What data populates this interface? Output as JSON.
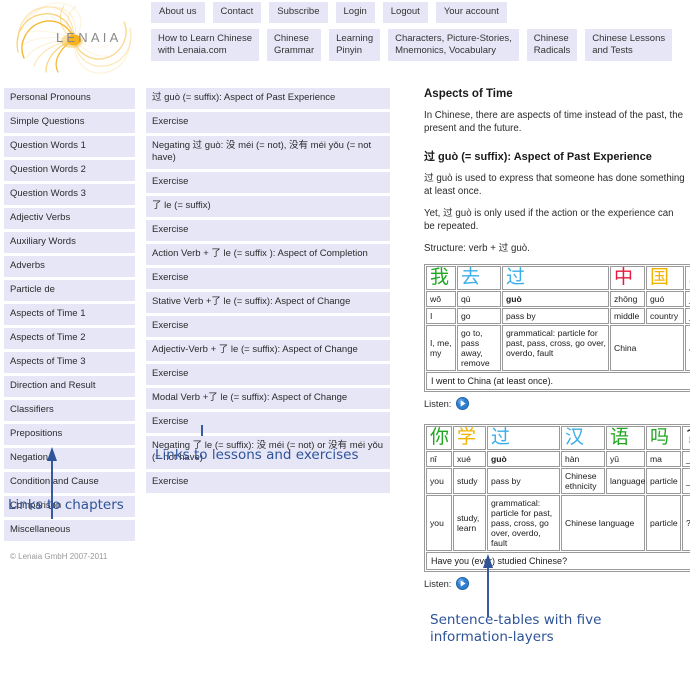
{
  "site": {
    "logo_text": "LENAIA",
    "logo_name": "lenaia-spiral-logo",
    "copyright": "© Lenaia GmbH 2007-2011"
  },
  "nav_top": [
    {
      "label": "About us"
    },
    {
      "label": "Contact"
    },
    {
      "label": "Subscribe"
    },
    {
      "label": "Login"
    },
    {
      "label": "Logout"
    },
    {
      "label": "Your account"
    }
  ],
  "nav_main": [
    {
      "label": "How to Learn Chinese\nwith Lenaia.com"
    },
    {
      "label": "Chinese\nGrammar"
    },
    {
      "label": "Learning\nPinyin"
    },
    {
      "label": "Characters, Picture-Stories,\nMnemonics, Vocabulary"
    },
    {
      "label": "Chinese\nRadicals"
    },
    {
      "label": "Chinese Lessons\nand Tests"
    }
  ],
  "chapters": [
    {
      "label": "Personal Pronouns"
    },
    {
      "label": "Simple Questions"
    },
    {
      "label": "Question Words 1"
    },
    {
      "label": "Question Words 2"
    },
    {
      "label": "Question Words 3"
    },
    {
      "label": "Adjectiv Verbs"
    },
    {
      "label": "Auxiliary Words"
    },
    {
      "label": "Adverbs"
    },
    {
      "label": "Particle de"
    },
    {
      "label": "Aspects of Time 1"
    },
    {
      "label": "Aspects of Time 2"
    },
    {
      "label": "Aspects of Time 3"
    },
    {
      "label": "Direction and Result"
    },
    {
      "label": "Classifiers"
    },
    {
      "label": "Prepositions"
    },
    {
      "label": "Negation"
    },
    {
      "label": "Condition and Cause"
    },
    {
      "label": "Comparison"
    },
    {
      "label": "Miscellaneous"
    }
  ],
  "lessons": [
    {
      "label": "过 guò (= suffix): Aspect of Past Experience"
    },
    {
      "label": "Exercise"
    },
    {
      "label": "Negating 过 guò: 没 méi (= not), 没有 méi yǒu (= not have)"
    },
    {
      "label": "Exercise"
    },
    {
      "label": "了 le (= suffix)"
    },
    {
      "label": "Exercise"
    },
    {
      "label": "Action Verb + 了 le (= suffix ): Aspect of Completion"
    },
    {
      "label": "Exercise"
    },
    {
      "label": "Stative Verb +了 le (= suffix): Aspect of Change"
    },
    {
      "label": "Exercise"
    },
    {
      "label": "Adjectiv-Verb + 了 le (= suffix): Aspect of Change"
    },
    {
      "label": "Exercise"
    },
    {
      "label": "Modal Verb +了 le (= suffix): Aspect of Change"
    },
    {
      "label": "Exercise"
    },
    {
      "label": "Negating 了 le (= suffix): 没 méi (= not) or 没有 méi yǒu (= not have)"
    },
    {
      "label": "Exercise"
    }
  ],
  "content": {
    "title": "Aspects of Time",
    "intro": "In Chinese, there are aspects of time instead of the past, the present and the future.",
    "subtitle": "过 guò (= suffix): Aspect of Past Experience",
    "p1": "过 guò is used to express that someone has done something at least once.",
    "p2": "Yet, 过 guò is only used if the action or the experience can be repeated.",
    "p3": "Structure: verb + 过 guò.",
    "listen_label": "Listen:"
  },
  "table1": {
    "hanzi": [
      {
        "ch": "我",
        "color": "green"
      },
      {
        "ch": "去",
        "color": "blue"
      },
      {
        "ch": "过",
        "color": "blue"
      },
      {
        "ch": "中",
        "color": "red"
      },
      {
        "ch": "国",
        "color": "gold"
      },
      {
        "ch": "。",
        "color": "punct"
      }
    ],
    "pinyin": [
      "wǒ",
      "qù",
      "guò",
      "zhōng",
      "guó",
      "_"
    ],
    "literal": [
      "I",
      "go",
      "pass by",
      "middle",
      "country",
      "_"
    ],
    "meaning": [
      "I, me, my",
      "go to, pass away, remove",
      "grammatical: particle for past, pass, cross, go over, overdo, fault",
      "China",
      "。"
    ],
    "translation": "I went to China (at least once)."
  },
  "table2": {
    "hanzi": [
      {
        "ch": "你",
        "color": "green"
      },
      {
        "ch": "学",
        "color": "gold"
      },
      {
        "ch": "过",
        "color": "blue"
      },
      {
        "ch": "汉",
        "color": "blue"
      },
      {
        "ch": "语",
        "color": "green"
      },
      {
        "ch": "吗",
        "color": "green"
      },
      {
        "ch": "?",
        "color": "punct"
      }
    ],
    "pinyin": [
      "nǐ",
      "xué",
      "guò",
      "hàn",
      "yǔ",
      "ma",
      "_"
    ],
    "literal": [
      "you",
      "study",
      "pass by",
      "Chinese ethnicity",
      "language",
      "particle",
      "_"
    ],
    "meaning": [
      "you",
      "study, learn",
      "grammatical: particle for past, pass, cross, go over, overdo, fault",
      "Chinese language",
      "particle",
      "?"
    ],
    "translation": "Have you (ever) studied Chinese?"
  },
  "annotations": {
    "chapters": "Links to chapters",
    "lessons": "Links to lessons and exercises",
    "tables": "Sentence-tables with five\ninformation-layers"
  },
  "colors": {
    "nav_bg": "#e7e6f7",
    "annotation": "#2e5398",
    "logo": "#f5b324",
    "hanzi_green": "#1fa81f",
    "hanzi_blue": "#3aaee8",
    "hanzi_red": "#e8183c",
    "hanzi_gold": "#f2b200"
  }
}
